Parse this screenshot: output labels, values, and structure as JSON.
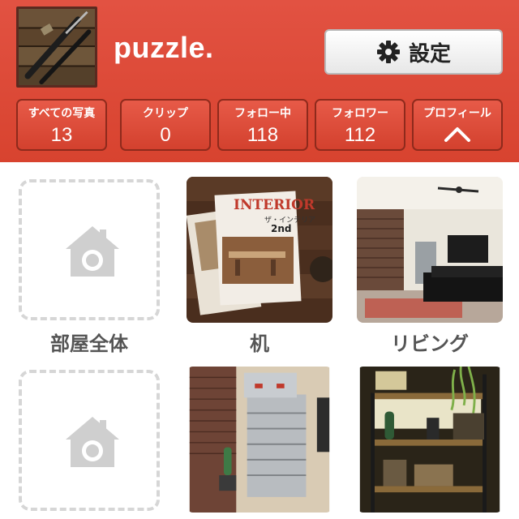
{
  "profile": {
    "username": "puzzle.",
    "avatar_alt": "avatar",
    "settings_label": "設定",
    "settings_icon": "gear-icon"
  },
  "stats": [
    {
      "label": "すべての写真",
      "value": "13"
    },
    {
      "label": "クリップ",
      "value": "0"
    },
    {
      "label": "フォロー中",
      "value": "118"
    },
    {
      "label": "フォロワー",
      "value": "112"
    },
    {
      "label": "プロフィール",
      "icon": "chevron-up-icon"
    }
  ],
  "rooms": [
    {
      "caption": "部屋全体",
      "empty": true
    },
    {
      "caption": "机",
      "empty": false
    },
    {
      "caption": "リビング",
      "empty": false
    },
    {
      "caption": "",
      "empty": true
    },
    {
      "caption": "",
      "empty": false
    },
    {
      "caption": "",
      "empty": false
    }
  ],
  "magazine": {
    "title": "INTERIOR",
    "subtitle": "ザ・インテリア",
    "edition": "2nd"
  },
  "colors": {
    "header": "#d8432f",
    "button_border": "#8e2a1c",
    "caption": "#555555",
    "placeholder": "#d6d6d6"
  }
}
